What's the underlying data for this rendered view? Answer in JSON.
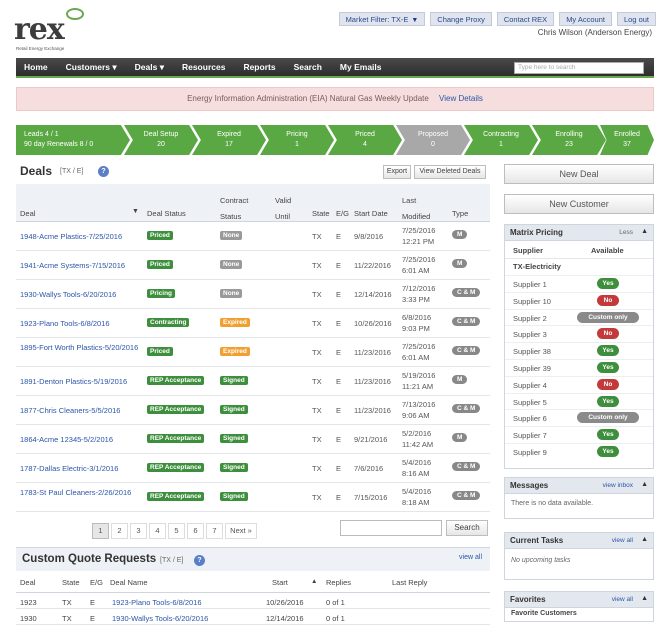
{
  "header": {
    "logo_text": "rex",
    "logo_tagline": "Retail Energy Exchange",
    "market_filter": "Market Filter: TX-E",
    "change_proxy": "Change Proxy",
    "contact_rex": "Contact REX",
    "my_account": "My Account",
    "log_out": "Log out",
    "user": "Chris Wilson (Anderson Energy)"
  },
  "nav": {
    "items": [
      "Home",
      "Customers ▾",
      "Deals ▾",
      "Resources",
      "Reports",
      "Search",
      "My Emails"
    ],
    "search_placeholder": "Type here to search"
  },
  "banner": {
    "text": "Energy Information Administration (EIA) Natural Gas Weekly Update",
    "link": "View Details"
  },
  "pipeline": [
    {
      "label": "Leads 4 / 1",
      "sub": "90 day Renewals 8 / 0",
      "state": "green"
    },
    {
      "label": "Deal Setup",
      "sub": "20",
      "state": "green"
    },
    {
      "label": "Expired",
      "sub": "17",
      "state": "green"
    },
    {
      "label": "Pricing",
      "sub": "1",
      "state": "green"
    },
    {
      "label": "Priced",
      "sub": "4",
      "state": "green"
    },
    {
      "label": "Proposed",
      "sub": "0",
      "state": "grey"
    },
    {
      "label": "Contracting",
      "sub": "1",
      "state": "green"
    },
    {
      "label": "Enrolling",
      "sub": "23",
      "state": "green"
    },
    {
      "label": "Enrolled",
      "sub": "37",
      "state": "green"
    }
  ],
  "deals": {
    "title": "Deals",
    "scope": "[TX / E]",
    "help": "?",
    "export_label": "Export",
    "view_deleted_label": "View Deleted Deals",
    "columns": {
      "deal": "Deal",
      "deal_status": "Deal Status",
      "contract_status": "Contract Status",
      "valid_until": "Valid Until",
      "state": "State",
      "eg": "E/G",
      "start_date": "Start Date",
      "last_modified": "Last Modified",
      "type": "Type"
    },
    "rows": [
      {
        "name": "1948-Acme Plastics-7/25/2016",
        "status": "Priced",
        "status_color": "green",
        "contract": "None",
        "contract_color": "grey",
        "state": "TX",
        "eg": "E",
        "start": "9/8/2016",
        "mod_date": "7/25/2016",
        "mod_time": "12:21 PM",
        "type": "M"
      },
      {
        "name": "1941-Acme Systems-7/15/2016",
        "status": "Priced",
        "status_color": "green",
        "contract": "None",
        "contract_color": "grey",
        "state": "TX",
        "eg": "E",
        "start": "11/22/2016",
        "mod_date": "7/25/2016",
        "mod_time": "6:01 AM",
        "type": "M"
      },
      {
        "name": "1930-Wallys Tools-6/20/2016",
        "status": "Pricing",
        "status_color": "green",
        "contract": "None",
        "contract_color": "grey",
        "state": "TX",
        "eg": "E",
        "start": "12/14/2016",
        "mod_date": "7/12/2016",
        "mod_time": "3:33 PM",
        "type": "C & M"
      },
      {
        "name": "1923-Plano Tools-6/8/2016",
        "status": "Contracting",
        "status_color": "green",
        "contract": "Expired",
        "contract_color": "orange",
        "state": "TX",
        "eg": "E",
        "start": "10/26/2016",
        "mod_date": "6/8/2016",
        "mod_time": "9:03 PM",
        "type": "C & M"
      },
      {
        "name": "1895-Fort Worth Plastics-5/20/2016",
        "status": "Priced",
        "status_color": "green",
        "contract": "Expired",
        "contract_color": "orange",
        "state": "TX",
        "eg": "E",
        "start": "11/23/2016",
        "mod_date": "7/25/2016",
        "mod_time": "6:01 AM",
        "type": "C & M"
      },
      {
        "name": "1891-Denton Plastics-5/19/2016",
        "status": "REP Acceptance",
        "status_color": "green",
        "contract": "Signed",
        "contract_color": "green",
        "state": "TX",
        "eg": "E",
        "start": "11/23/2016",
        "mod_date": "5/19/2016",
        "mod_time": "11:21 AM",
        "type": "M"
      },
      {
        "name": "1877-Chris Cleaners-5/5/2016",
        "status": "REP Acceptance",
        "status_color": "green",
        "contract": "Signed",
        "contract_color": "green",
        "state": "TX",
        "eg": "E",
        "start": "11/23/2016",
        "mod_date": "7/13/2016",
        "mod_time": "9:06 AM",
        "type": "C & M"
      },
      {
        "name": "1864-Acme 12345-5/2/2016",
        "status": "REP Acceptance",
        "status_color": "green",
        "contract": "Signed",
        "contract_color": "green",
        "state": "TX",
        "eg": "E",
        "start": "9/21/2016",
        "mod_date": "5/2/2016",
        "mod_time": "11:42 AM",
        "type": "M"
      },
      {
        "name": "1787-Dallas Electric-3/1/2016",
        "status": "REP Acceptance",
        "status_color": "green",
        "contract": "Signed",
        "contract_color": "green",
        "state": "TX",
        "eg": "E",
        "start": "7/6/2016",
        "mod_date": "5/4/2016",
        "mod_time": "8:16 AM",
        "type": "C & M"
      },
      {
        "name": "1783-St Paul Cleaners-2/26/2016",
        "status": "REP Acceptance",
        "status_color": "green",
        "contract": "Signed",
        "contract_color": "green",
        "state": "TX",
        "eg": "E",
        "start": "7/15/2016",
        "mod_date": "5/4/2016",
        "mod_time": "8:18 AM",
        "type": "C & M"
      }
    ],
    "pages": [
      "1",
      "2",
      "3",
      "4",
      "5",
      "6",
      "7",
      "Next »"
    ],
    "current_page": "1",
    "search_button": "Search"
  },
  "custom_quotes": {
    "title": "Custom Quote Requests",
    "scope": "[TX / E]",
    "help": "?",
    "view_all": "view all",
    "columns": {
      "deal": "Deal",
      "state": "State",
      "eg": "E/G",
      "deal_name": "Deal Name",
      "start": "Start",
      "sort": "▲",
      "replies": "Replies",
      "last_reply": "Last Reply"
    },
    "rows": [
      {
        "deal": "1923",
        "state": "TX",
        "eg": "E",
        "name": "1923-Plano Tools-6/8/2016",
        "start": "10/26/2016",
        "replies": "0 of 1"
      },
      {
        "deal": "1930",
        "state": "TX",
        "eg": "E",
        "name": "1930-Wallys Tools-6/20/2016",
        "start": "12/14/2016",
        "replies": "0 of 1"
      }
    ]
  },
  "sidebar": {
    "new_deal": "New Deal",
    "new_customer": "New Customer",
    "matrix_pricing": {
      "title": "Matrix Pricing",
      "less": "Less",
      "supplier_col": "Supplier",
      "available_col": "Available",
      "group": "TX-Electricity",
      "suppliers": [
        {
          "name": "Supplier 1",
          "avail": "Yes",
          "kind": "yes"
        },
        {
          "name": "Supplier 10",
          "avail": "No",
          "kind": "no"
        },
        {
          "name": "Supplier 2",
          "avail": "Custom only",
          "kind": "cust"
        },
        {
          "name": "Supplier 3",
          "avail": "No",
          "kind": "no"
        },
        {
          "name": "Supplier 38",
          "avail": "Yes",
          "kind": "yes"
        },
        {
          "name": "Supplier 39",
          "avail": "Yes",
          "kind": "yes"
        },
        {
          "name": "Supplier 4",
          "avail": "No",
          "kind": "no"
        },
        {
          "name": "Supplier 5",
          "avail": "Yes",
          "kind": "yes"
        },
        {
          "name": "Supplier 6",
          "avail": "Custom only",
          "kind": "cust"
        },
        {
          "name": "Supplier 7",
          "avail": "Yes",
          "kind": "yes"
        },
        {
          "name": "Supplier 9",
          "avail": "Yes",
          "kind": "yes"
        }
      ]
    },
    "messages": {
      "title": "Messages",
      "link": "view inbox",
      "body": "There is no data available."
    },
    "tasks": {
      "title": "Current Tasks",
      "link": "view all",
      "body": "No upcoming tasks"
    },
    "favorites": {
      "title": "Favorites",
      "link": "view all",
      "body": "Favorite Customers"
    }
  },
  "colors": {
    "green": "#3d8f3d",
    "grey": "#9a9a9a",
    "orange": "#f0a030",
    "red": "#c23a3a",
    "nav": "#2d2d2d",
    "accent": "#6aa84f"
  }
}
